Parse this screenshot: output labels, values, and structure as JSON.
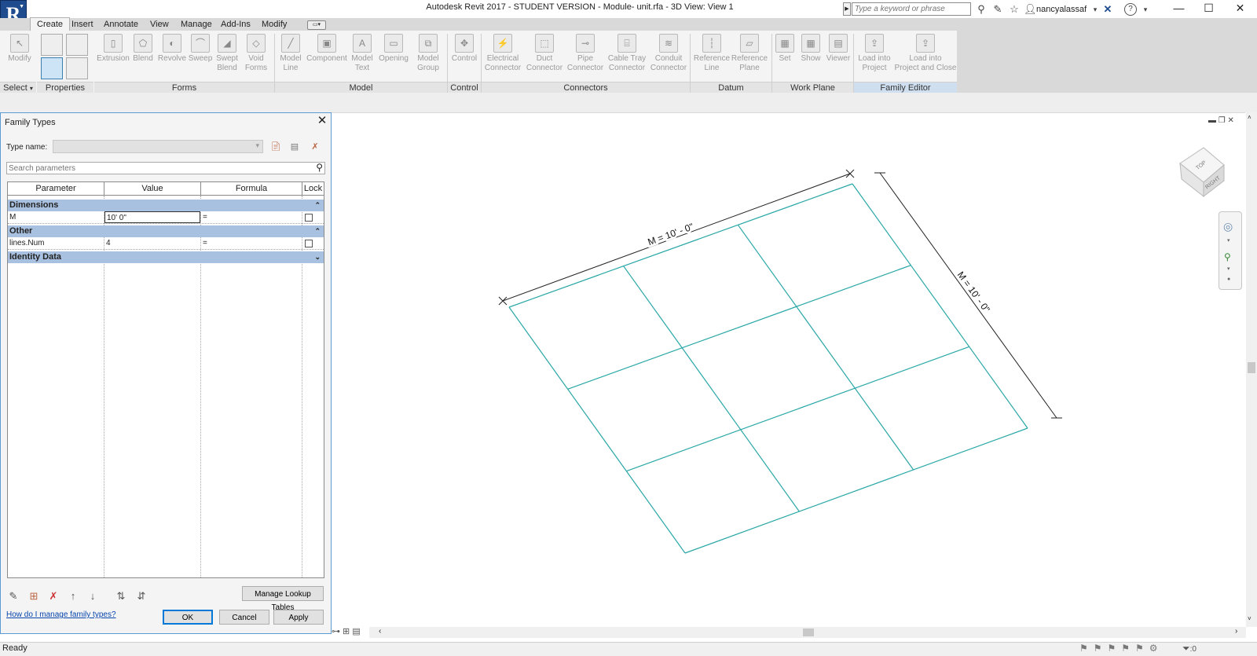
{
  "window": {
    "title": "Autodesk Revit 2017 - STUDENT VERSION -     Module- unit.rfa - 3D View: View 1",
    "search_placeholder": "Type a keyword or phrase",
    "user": "nancyalassaf",
    "logo": "R"
  },
  "tabs": [
    "Create",
    "Insert",
    "Annotate",
    "View",
    "Manage",
    "Add-Ins",
    "Modify"
  ],
  "active_tab": "Create",
  "ribbon": {
    "buttons": {
      "modify": "Modify",
      "extrusion": "Extrusion",
      "blend": "Blend",
      "revolve": "Revolve",
      "sweep": "Sweep",
      "swept_blend_1": "Swept",
      "swept_blend_2": "Blend",
      "void_forms_1": "Void",
      "void_forms_2": "Forms",
      "model_line_1": "Model",
      "model_line_2": "Line",
      "component": "Component",
      "model_text_1": "Model",
      "model_text_2": "Text",
      "opening": "Opening",
      "model_group_1": "Model",
      "model_group_2": "Group",
      "control": "Control",
      "electrical_1": "Electrical",
      "electrical_2": "Connector",
      "duct_1": "Duct",
      "duct_2": "Connector",
      "pipe_1": "Pipe",
      "pipe_2": "Connector",
      "cable_1": "Cable Tray",
      "cable_2": "Connector",
      "conduit_1": "Conduit",
      "conduit_2": "Connector",
      "ref_line_1": "Reference",
      "ref_line_2": "Line",
      "ref_plane_1": "Reference",
      "ref_plane_2": "Plane",
      "set": "Set",
      "show": "Show",
      "viewer": "Viewer",
      "load_1": "Load into",
      "load_2": "Project",
      "load_close_1": "Load into",
      "load_close_2": "Project and Close"
    },
    "panels": {
      "select": "Select",
      "properties": "Properties",
      "forms": "Forms",
      "model": "Model",
      "control": "Control",
      "connectors": "Connectors",
      "datum": "Datum",
      "work_plane": "Work Plane",
      "family_editor": "Family Editor"
    }
  },
  "dialog": {
    "title": "Family Types",
    "type_name_label": "Type name:",
    "type_name_value": "",
    "search_placeholder": "Search parameters",
    "columns": [
      "Parameter",
      "Value",
      "Formula",
      "Lock"
    ],
    "groups": [
      {
        "name": "Dimensions",
        "rows": [
          {
            "parameter": "M",
            "value": "10'  0\"",
            "formula": "=",
            "locked": false
          }
        ]
      },
      {
        "name": "Other",
        "rows": [
          {
            "parameter": "lines.Num",
            "value": "4",
            "formula": "=",
            "locked": false
          }
        ]
      },
      {
        "name": "Identity Data",
        "rows": []
      }
    ],
    "manage_lookup": "Manage Lookup Tables",
    "help_link": "How do I manage family types?",
    "ok": "OK",
    "cancel": "Cancel",
    "apply": "Apply"
  },
  "viewport": {
    "dimension_top": "M = 10' - 0\"",
    "dimension_right": "M = 10' - 0\"",
    "grid_divisions": 3,
    "line_color": "#2aa7a7",
    "viewcube_top": "TOP",
    "viewcube_right": "RIGHT"
  },
  "status": {
    "text": "Ready",
    "filter_count": ":0"
  }
}
